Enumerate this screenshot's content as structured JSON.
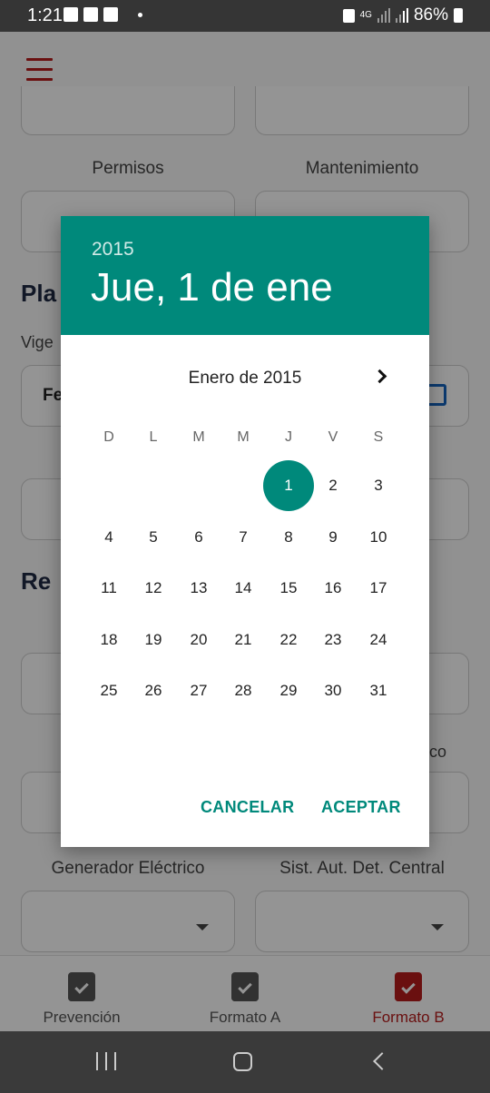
{
  "status_bar": {
    "time": "1:21",
    "network": "4G",
    "battery": "86%"
  },
  "background": {
    "permisos_label": "Permisos",
    "mantenimiento_label": "Mantenimiento",
    "section1_title": "Pla",
    "vigencia_label": "Vige",
    "date_field_text": "Fe",
    "section2_title": "Re",
    "partial_label": "co",
    "generador_label": "Generador Eléctrico",
    "sist_label": "Sist. Aut. Det. Central"
  },
  "bottom_nav": {
    "items": [
      {
        "label": "Prevención",
        "active": false
      },
      {
        "label": "Formato A",
        "active": false
      },
      {
        "label": "Formato B",
        "active": true
      }
    ],
    "active_color": "#b71c1c",
    "inactive_color": "#555555"
  },
  "date_picker": {
    "header_year": "2015",
    "header_date": "Jue, 1 de ene",
    "month_label": "Enero de 2015",
    "weekdays": [
      "D",
      "L",
      "M",
      "M",
      "J",
      "V",
      "S"
    ],
    "days": [
      "1",
      "2",
      "3",
      "4",
      "5",
      "6",
      "7",
      "8",
      "9",
      "10",
      "11",
      "12",
      "13",
      "14",
      "15",
      "16",
      "17",
      "18",
      "19",
      "20",
      "21",
      "22",
      "23",
      "24",
      "25",
      "26",
      "27",
      "28",
      "29",
      "30",
      "31"
    ],
    "first_weekday_index": 4,
    "selected_day": "1",
    "cancel_label": "CANCELAR",
    "accept_label": "ACEPTAR",
    "accent_color": "#00897b"
  }
}
